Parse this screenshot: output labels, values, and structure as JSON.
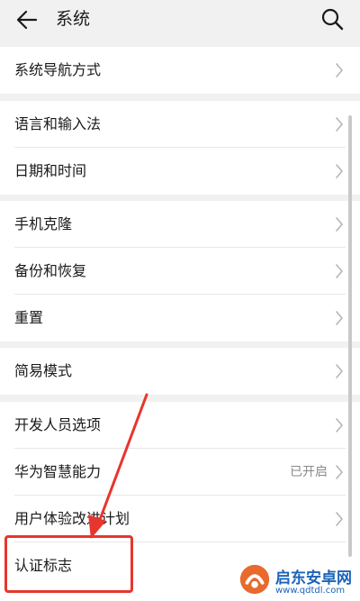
{
  "header": {
    "title": "系统"
  },
  "groups": [
    {
      "items": [
        {
          "label": "系统导航方式"
        }
      ]
    },
    {
      "items": [
        {
          "label": "语言和输入法"
        },
        {
          "label": "日期和时间"
        }
      ]
    },
    {
      "items": [
        {
          "label": "手机克隆"
        },
        {
          "label": "备份和恢复"
        },
        {
          "label": "重置"
        }
      ]
    },
    {
      "items": [
        {
          "label": "简易模式"
        }
      ]
    },
    {
      "items": [
        {
          "label": "开发人员选项"
        },
        {
          "label": "华为智慧能力",
          "value": "已开启"
        },
        {
          "label": "用户体验改进计划"
        },
        {
          "label": "认证标志"
        }
      ]
    }
  ],
  "watermark": {
    "brand": "启东安卓网",
    "url": "www.qdtdl.com"
  },
  "colors": {
    "accent": "#e8352d",
    "watermark": "#1c63b8"
  },
  "icons": {
    "back": "back-arrow-icon",
    "search": "search-icon",
    "chevron": "chevron-right-icon"
  }
}
